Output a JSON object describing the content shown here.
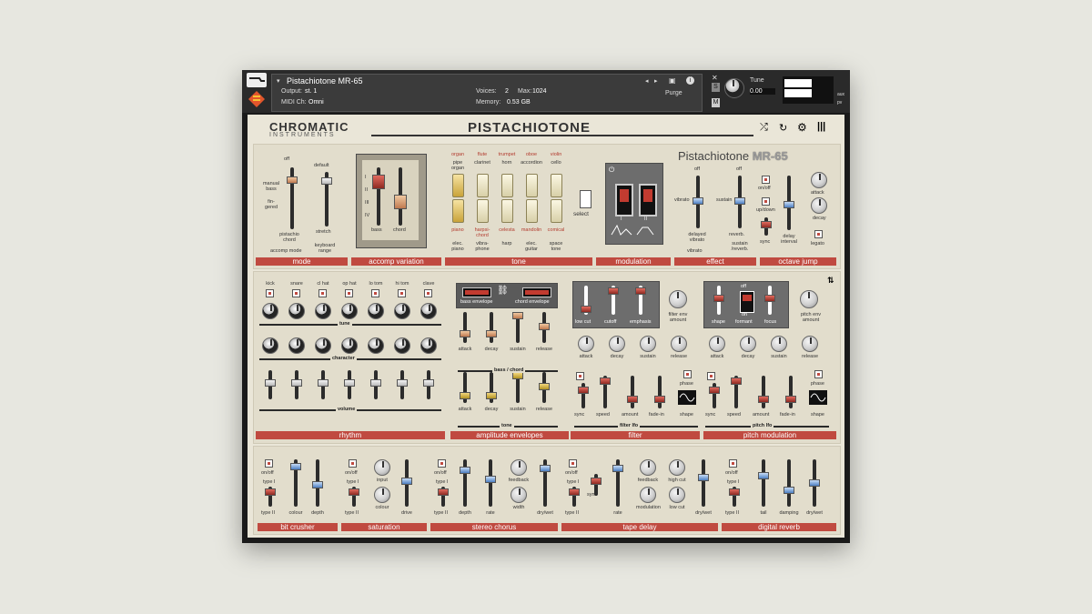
{
  "header": {
    "instrument_name": "Pistachiotone MR-65",
    "output_label": "Output:",
    "output_value": "st. 1",
    "midi_label": "MIDI Ch:",
    "midi_value": "Omni",
    "voices_label": "Voices:",
    "voices_value": "2",
    "max_label": "Max:",
    "max_value": "1024",
    "memory_label": "Memory:",
    "memory_value": "0.53 GB",
    "purge_label": "Purge",
    "tune_label": "Tune",
    "tune_value": "0.00",
    "s_label": "S",
    "m_label": "M",
    "aux_label": "aux",
    "pv_label": "pv"
  },
  "brand": {
    "line1": "CHROMATIC",
    "line2": "INSTRUMENTS",
    "title": "PISTACHIOTONE",
    "model": "Pistachiotone",
    "model_code": "MR-65"
  },
  "sections": {
    "mode": "mode",
    "accomp_variation": "accomp variation",
    "tone": "tone",
    "modulation": "modulation",
    "effect": "effect",
    "octave_jump": "octave jump",
    "rhythm": "rhythm",
    "amplitude_envelopes": "amplitude envelopes",
    "filter": "filter",
    "pitch_modulation": "pitch modulation",
    "bit_crusher": "bit crusher",
    "saturation": "saturation",
    "stereo_chorus": "stereo chorus",
    "tape_delay": "tape delay",
    "digital_reverb": "digital reverb"
  },
  "mode": {
    "off": "off",
    "manual_bass": "manual bass",
    "fingered": "fin-gered",
    "pistachio_chord": "pistachio chord",
    "accomp_mode": "accomp mode",
    "default": "default",
    "stretch": "stretch",
    "keyboard_range": "keyboard range"
  },
  "accomp": {
    "bass": "bass",
    "chord": "chord",
    "ticks": [
      "I",
      "II",
      "III",
      "IV"
    ]
  },
  "tone": {
    "top": [
      "organ",
      "flute",
      "trumpet",
      "oboe",
      "violin"
    ],
    "top_sub": [
      "pipe organ",
      "clarinet",
      "horn",
      "accordion",
      "cello"
    ],
    "bottom": [
      "piano",
      "harpsi-chord",
      "celesta",
      "mandolin",
      "comical"
    ],
    "bottom_sub": [
      "elec. piano",
      "vibra-phone",
      "harp",
      "elec. guitar",
      "space tone"
    ],
    "select": "select"
  },
  "modulation": {
    "i": "I",
    "ii": "II"
  },
  "effect": {
    "off1": "off",
    "vibrato": "vibrato",
    "delayed_vibrato": "delayed vibrato",
    "vibrato_title": "vibrato",
    "off2": "off",
    "sustain": "sustain",
    "reverb": "reverb.",
    "sustain_reverb": "sustain /reverb."
  },
  "octave": {
    "on_off": "on/off",
    "up_down": "up/down",
    "sync": "sync",
    "delay_interval": "delay interval",
    "attack": "attack",
    "decay": "decay",
    "legato": "legato"
  },
  "rhythm": {
    "drums": [
      "kick",
      "snare",
      "cl hat",
      "op hat",
      "lo tom",
      "hi tom",
      "clave"
    ],
    "tune": "tune",
    "character": "character",
    "volume": "volume"
  },
  "amp": {
    "bass_env": "bass envelope",
    "chord_env": "chord envelope",
    "bass_chord": "bass / chord",
    "tone": "tone",
    "attack": "attack",
    "decay": "decay",
    "sustain": "sustain",
    "release": "release"
  },
  "filter": {
    "low_cut": "low cut",
    "cutoff": "cutoff",
    "emphasis": "emphasis",
    "env_amount": "filter env amount",
    "attack": "attack",
    "decay": "decay",
    "sustain": "sustain",
    "release": "release",
    "sync": "sync",
    "speed": "speed",
    "amount": "amount",
    "fade_in": "fade-in",
    "phase": "phase",
    "shape": "shape",
    "lfo": "filter lfo"
  },
  "pitch": {
    "off": "off",
    "on": "on",
    "shape": "shape",
    "formant": "formant",
    "focus": "focus",
    "env_amount": "pitch env amount",
    "attack": "attack",
    "decay": "decay",
    "sustain": "sustain",
    "release": "release",
    "sync": "sync",
    "speed": "speed",
    "amount": "amount",
    "fade_in": "fade-in",
    "phase": "phase",
    "shape2": "shape",
    "lfo": "pitch lfo"
  },
  "fx": {
    "on_off": "on/off",
    "type_i": "type I",
    "type_ii": "type II",
    "colour": "colour",
    "depth": "depth",
    "input": "input",
    "drive": "drive",
    "rate": "rate",
    "feedback": "feedback",
    "width": "width",
    "dry_wet": "dry/wet",
    "sync": "sync",
    "modulation": "modulation",
    "high_cut": "high cut",
    "low_cut": "low cut",
    "tail": "tail",
    "damping": "damping"
  }
}
